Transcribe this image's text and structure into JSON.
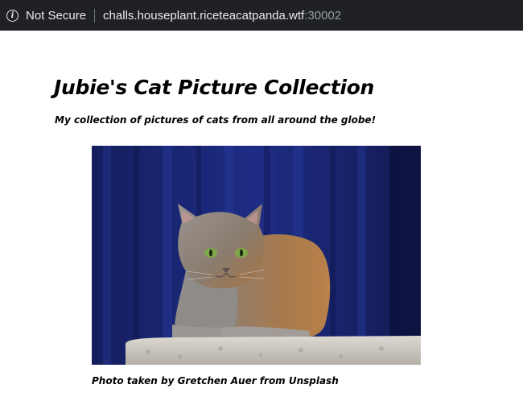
{
  "browser": {
    "security_label": "Not Secure",
    "url_host": "challs.houseplant.riceteacatpanda.wtf",
    "url_port": ":30002",
    "info_icon": "info-icon"
  },
  "page": {
    "title": "Jubie's Cat Picture Collection",
    "subtitle": "My collection of pictures of cats from all around the globe!",
    "photo_caption": "Photo taken by Gretchen Auer from Unsplash"
  },
  "colors": {
    "toolbar": "#202124",
    "curtain": "#1c2a78",
    "cat_fur": "#8e8a86",
    "cat_warm": "#b57a4a",
    "cat_eyes": "#7fa84a",
    "tower": "#c9c6c0"
  }
}
